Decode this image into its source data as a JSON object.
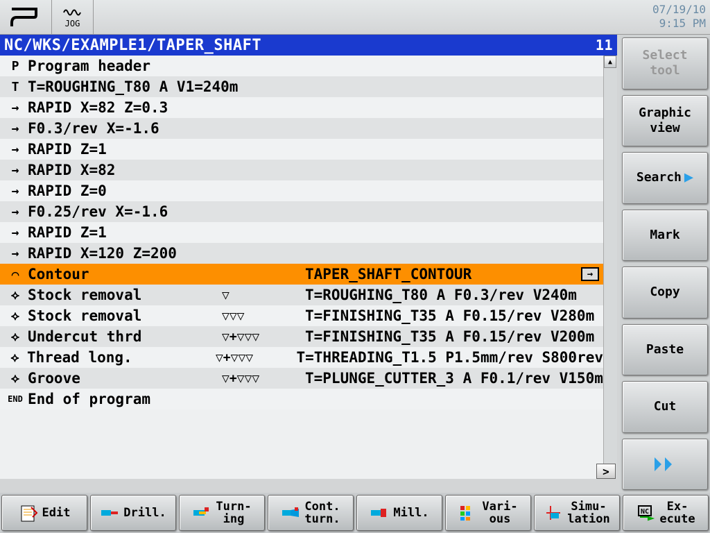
{
  "header": {
    "jog_label": "JOG",
    "date": "07/19/10",
    "time": "9:15 PM"
  },
  "path": {
    "text": "NC/WKS/EXAMPLE1/TAPER_SHAFT",
    "line_no": "11"
  },
  "program": [
    {
      "icon": "P",
      "label": "Program header",
      "mid": "",
      "param": ""
    },
    {
      "icon": "T",
      "label": "T=ROUGHING_T80 A V1=240m",
      "mid": "",
      "param": ""
    },
    {
      "icon": "→",
      "label": "RAPID X=82 Z=0.3",
      "mid": "",
      "param": ""
    },
    {
      "icon": "→",
      "label": "F0.3/rev X=-1.6",
      "mid": "",
      "param": ""
    },
    {
      "icon": "→",
      "label": "RAPID Z=1",
      "mid": "",
      "param": ""
    },
    {
      "icon": "→",
      "label": "RAPID X=82",
      "mid": "",
      "param": ""
    },
    {
      "icon": "→",
      "label": "RAPID Z=0",
      "mid": "",
      "param": ""
    },
    {
      "icon": "→",
      "label": "F0.25/rev X=-1.6",
      "mid": "",
      "param": ""
    },
    {
      "icon": "→",
      "label": "RAPID Z=1",
      "mid": "",
      "param": ""
    },
    {
      "icon": "→",
      "label": "RAPID X=120 Z=200",
      "mid": "",
      "param": ""
    },
    {
      "icon": "⌒",
      "label": "Contour",
      "mid": "",
      "param": "TAPER_SHAFT_CONTOUR",
      "selected": true,
      "arrow": true
    },
    {
      "icon": "⟡",
      "label": "Stock removal",
      "mid": "▽",
      "param": "T=ROUGHING_T80 A F0.3/rev V240m"
    },
    {
      "icon": "⟡",
      "label": "Stock removal",
      "mid": "▽▽▽",
      "param": "T=FINISHING_T35 A F0.15/rev V280m"
    },
    {
      "icon": "⟡",
      "label": "Undercut thrd",
      "mid": "▽+▽▽▽",
      "param": "T=FINISHING_T35 A F0.15/rev V200m"
    },
    {
      "icon": "⟡",
      "label": "Thread long.",
      "mid": "▽+▽▽▽",
      "param": "T=THREADING_T1.5 P1.5mm/rev S800rev"
    },
    {
      "icon": "⟡",
      "label": "Groove",
      "mid": "▽+▽▽▽",
      "param": "T=PLUNGE_CUTTER_3 A F0.1/rev V150m"
    },
    {
      "icon": "END",
      "label": "End of program",
      "mid": "",
      "param": "",
      "end": true
    }
  ],
  "vkeys": [
    {
      "label": "Select\ntool",
      "disabled": true,
      "name": "select-tool-button"
    },
    {
      "label": "Graphic\nview",
      "name": "graphic-view-button"
    },
    {
      "label": "Search",
      "arrow": true,
      "name": "search-button"
    },
    {
      "label": "Mark",
      "name": "mark-button"
    },
    {
      "label": "Copy",
      "name": "copy-button"
    },
    {
      "label": "Paste",
      "name": "paste-button"
    },
    {
      "label": "Cut",
      "name": "cut-button"
    },
    {
      "label": "",
      "fwd": true,
      "name": "forward-button"
    }
  ],
  "hkeys": [
    {
      "label": "Edit",
      "name": "edit-button",
      "icon": "edit"
    },
    {
      "label": "Drill.",
      "name": "drill-button",
      "icon": "drill"
    },
    {
      "label": "Turn-\ning",
      "name": "turning-button",
      "icon": "turn"
    },
    {
      "label": "Cont.\nturn.",
      "name": "contour-turn-button",
      "icon": "cturn"
    },
    {
      "label": "Mill.",
      "name": "milling-button",
      "icon": "mill"
    },
    {
      "label": "Vari-\nous",
      "name": "various-button",
      "icon": "var"
    },
    {
      "label": "Simu-\nlation",
      "name": "simulation-button",
      "icon": "sim"
    },
    {
      "label": "Ex-\necute",
      "name": "execute-button",
      "icon": "exec"
    }
  ]
}
